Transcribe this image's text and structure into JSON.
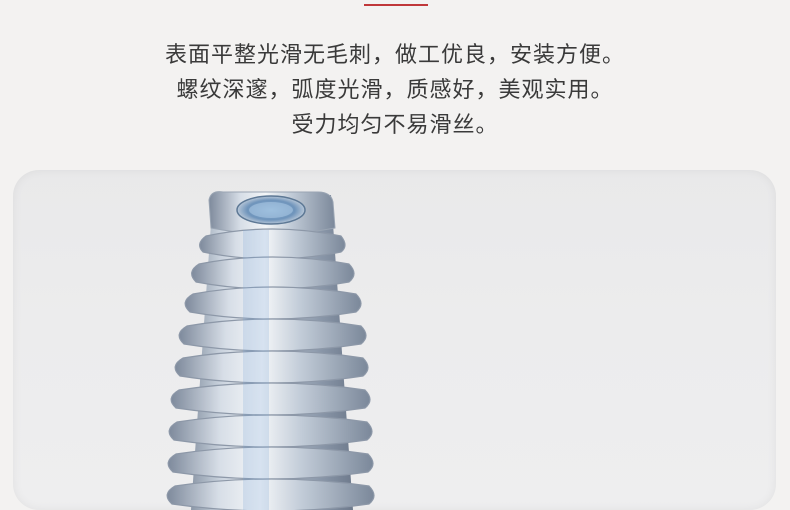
{
  "description": {
    "lines": [
      "表面平整光滑无毛刺，做工优良，安装方便。",
      "螺纹深邃，弧度光滑，质感好，美观实用。",
      "受力均匀不易滑丝。"
    ]
  },
  "colors": {
    "accent": "#c0383a",
    "background": "#f3f2f1",
    "text": "#3a3a3a"
  }
}
